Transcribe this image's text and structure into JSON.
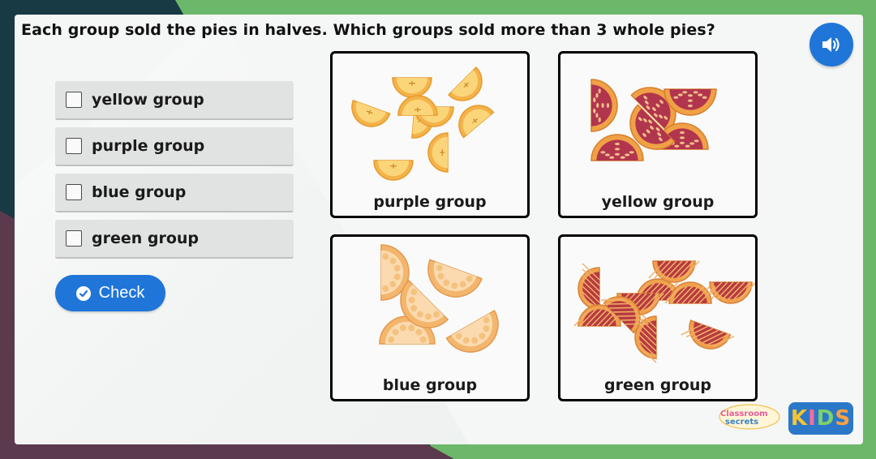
{
  "question": "Each group sold the pies in halves. Which groups sold more than 3 whole pies?",
  "options": [
    {
      "label": "yellow group"
    },
    {
      "label": "purple group"
    },
    {
      "label": "blue group"
    },
    {
      "label": "green group"
    }
  ],
  "check_button": {
    "label": "Check"
  },
  "panels": [
    {
      "label": "purple group",
      "border": "#c98cc7",
      "halves": 9,
      "pie_type": "apple"
    },
    {
      "label": "yellow group",
      "border": "#f0b400",
      "halves": 6,
      "pie_type": "cherry"
    },
    {
      "label": "blue group",
      "border": "#2ab4cf",
      "halves": 5,
      "pie_type": "custard"
    },
    {
      "label": "green group",
      "border": "#74c06a",
      "halves": 10,
      "pie_type": "lattice"
    }
  ],
  "icons": {
    "audio": "speaker-icon",
    "check": "checkmark-icon"
  },
  "colors": {
    "accent": "#1f75d8"
  },
  "brand": {
    "word1": "Classroom",
    "word2": "secrets",
    "kids": [
      "K",
      "I",
      "D",
      "S"
    ]
  }
}
